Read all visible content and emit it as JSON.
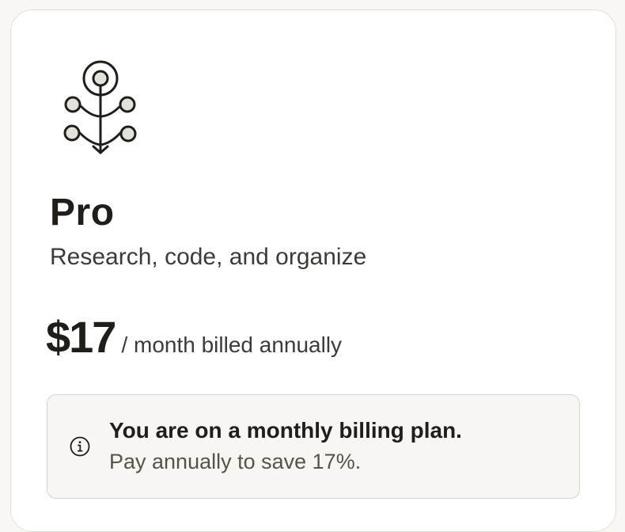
{
  "plan": {
    "icon": "sprout-branch-icon",
    "name": "Pro",
    "tagline": "Research, code, and organize",
    "price": "$17",
    "period": "/ month billed annually"
  },
  "notice": {
    "icon": "info-icon",
    "title": "You are on a monthly billing plan.",
    "body": "Pay annually to save 17%."
  },
  "colors": {
    "page_background": "#f8f7f3",
    "card_background": "#ffffff",
    "notice_background": "#f7f6f2",
    "text_primary": "#1f1e1b",
    "text_secondary": "#3d3b37"
  }
}
